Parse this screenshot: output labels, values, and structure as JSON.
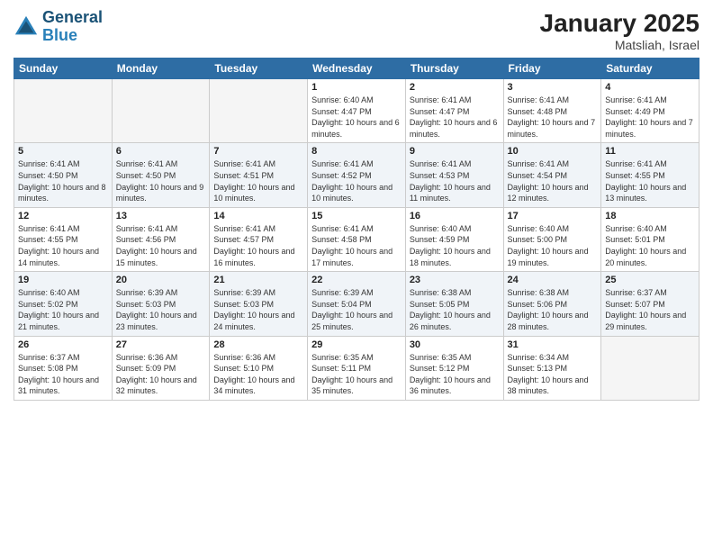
{
  "header": {
    "logo_line1": "General",
    "logo_line2": "Blue",
    "month_title": "January 2025",
    "location": "Matsliah, Israel"
  },
  "weekdays": [
    "Sunday",
    "Monday",
    "Tuesday",
    "Wednesday",
    "Thursday",
    "Friday",
    "Saturday"
  ],
  "weeks": [
    [
      {
        "day": "",
        "sunrise": "",
        "sunset": "",
        "daylight": "",
        "empty": true
      },
      {
        "day": "",
        "sunrise": "",
        "sunset": "",
        "daylight": "",
        "empty": true
      },
      {
        "day": "",
        "sunrise": "",
        "sunset": "",
        "daylight": "",
        "empty": true
      },
      {
        "day": "1",
        "sunrise": "Sunrise: 6:40 AM",
        "sunset": "Sunset: 4:47 PM",
        "daylight": "Daylight: 10 hours and 6 minutes.",
        "empty": false
      },
      {
        "day": "2",
        "sunrise": "Sunrise: 6:41 AM",
        "sunset": "Sunset: 4:47 PM",
        "daylight": "Daylight: 10 hours and 6 minutes.",
        "empty": false
      },
      {
        "day": "3",
        "sunrise": "Sunrise: 6:41 AM",
        "sunset": "Sunset: 4:48 PM",
        "daylight": "Daylight: 10 hours and 7 minutes.",
        "empty": false
      },
      {
        "day": "4",
        "sunrise": "Sunrise: 6:41 AM",
        "sunset": "Sunset: 4:49 PM",
        "daylight": "Daylight: 10 hours and 7 minutes.",
        "empty": false
      }
    ],
    [
      {
        "day": "5",
        "sunrise": "Sunrise: 6:41 AM",
        "sunset": "Sunset: 4:50 PM",
        "daylight": "Daylight: 10 hours and 8 minutes.",
        "empty": false
      },
      {
        "day": "6",
        "sunrise": "Sunrise: 6:41 AM",
        "sunset": "Sunset: 4:50 PM",
        "daylight": "Daylight: 10 hours and 9 minutes.",
        "empty": false
      },
      {
        "day": "7",
        "sunrise": "Sunrise: 6:41 AM",
        "sunset": "Sunset: 4:51 PM",
        "daylight": "Daylight: 10 hours and 10 minutes.",
        "empty": false
      },
      {
        "day": "8",
        "sunrise": "Sunrise: 6:41 AM",
        "sunset": "Sunset: 4:52 PM",
        "daylight": "Daylight: 10 hours and 10 minutes.",
        "empty": false
      },
      {
        "day": "9",
        "sunrise": "Sunrise: 6:41 AM",
        "sunset": "Sunset: 4:53 PM",
        "daylight": "Daylight: 10 hours and 11 minutes.",
        "empty": false
      },
      {
        "day": "10",
        "sunrise": "Sunrise: 6:41 AM",
        "sunset": "Sunset: 4:54 PM",
        "daylight": "Daylight: 10 hours and 12 minutes.",
        "empty": false
      },
      {
        "day": "11",
        "sunrise": "Sunrise: 6:41 AM",
        "sunset": "Sunset: 4:55 PM",
        "daylight": "Daylight: 10 hours and 13 minutes.",
        "empty": false
      }
    ],
    [
      {
        "day": "12",
        "sunrise": "Sunrise: 6:41 AM",
        "sunset": "Sunset: 4:55 PM",
        "daylight": "Daylight: 10 hours and 14 minutes.",
        "empty": false
      },
      {
        "day": "13",
        "sunrise": "Sunrise: 6:41 AM",
        "sunset": "Sunset: 4:56 PM",
        "daylight": "Daylight: 10 hours and 15 minutes.",
        "empty": false
      },
      {
        "day": "14",
        "sunrise": "Sunrise: 6:41 AM",
        "sunset": "Sunset: 4:57 PM",
        "daylight": "Daylight: 10 hours and 16 minutes.",
        "empty": false
      },
      {
        "day": "15",
        "sunrise": "Sunrise: 6:41 AM",
        "sunset": "Sunset: 4:58 PM",
        "daylight": "Daylight: 10 hours and 17 minutes.",
        "empty": false
      },
      {
        "day": "16",
        "sunrise": "Sunrise: 6:40 AM",
        "sunset": "Sunset: 4:59 PM",
        "daylight": "Daylight: 10 hours and 18 minutes.",
        "empty": false
      },
      {
        "day": "17",
        "sunrise": "Sunrise: 6:40 AM",
        "sunset": "Sunset: 5:00 PM",
        "daylight": "Daylight: 10 hours and 19 minutes.",
        "empty": false
      },
      {
        "day": "18",
        "sunrise": "Sunrise: 6:40 AM",
        "sunset": "Sunset: 5:01 PM",
        "daylight": "Daylight: 10 hours and 20 minutes.",
        "empty": false
      }
    ],
    [
      {
        "day": "19",
        "sunrise": "Sunrise: 6:40 AM",
        "sunset": "Sunset: 5:02 PM",
        "daylight": "Daylight: 10 hours and 21 minutes.",
        "empty": false
      },
      {
        "day": "20",
        "sunrise": "Sunrise: 6:39 AM",
        "sunset": "Sunset: 5:03 PM",
        "daylight": "Daylight: 10 hours and 23 minutes.",
        "empty": false
      },
      {
        "day": "21",
        "sunrise": "Sunrise: 6:39 AM",
        "sunset": "Sunset: 5:03 PM",
        "daylight": "Daylight: 10 hours and 24 minutes.",
        "empty": false
      },
      {
        "day": "22",
        "sunrise": "Sunrise: 6:39 AM",
        "sunset": "Sunset: 5:04 PM",
        "daylight": "Daylight: 10 hours and 25 minutes.",
        "empty": false
      },
      {
        "day": "23",
        "sunrise": "Sunrise: 6:38 AM",
        "sunset": "Sunset: 5:05 PM",
        "daylight": "Daylight: 10 hours and 26 minutes.",
        "empty": false
      },
      {
        "day": "24",
        "sunrise": "Sunrise: 6:38 AM",
        "sunset": "Sunset: 5:06 PM",
        "daylight": "Daylight: 10 hours and 28 minutes.",
        "empty": false
      },
      {
        "day": "25",
        "sunrise": "Sunrise: 6:37 AM",
        "sunset": "Sunset: 5:07 PM",
        "daylight": "Daylight: 10 hours and 29 minutes.",
        "empty": false
      }
    ],
    [
      {
        "day": "26",
        "sunrise": "Sunrise: 6:37 AM",
        "sunset": "Sunset: 5:08 PM",
        "daylight": "Daylight: 10 hours and 31 minutes.",
        "empty": false
      },
      {
        "day": "27",
        "sunrise": "Sunrise: 6:36 AM",
        "sunset": "Sunset: 5:09 PM",
        "daylight": "Daylight: 10 hours and 32 minutes.",
        "empty": false
      },
      {
        "day": "28",
        "sunrise": "Sunrise: 6:36 AM",
        "sunset": "Sunset: 5:10 PM",
        "daylight": "Daylight: 10 hours and 34 minutes.",
        "empty": false
      },
      {
        "day": "29",
        "sunrise": "Sunrise: 6:35 AM",
        "sunset": "Sunset: 5:11 PM",
        "daylight": "Daylight: 10 hours and 35 minutes.",
        "empty": false
      },
      {
        "day": "30",
        "sunrise": "Sunrise: 6:35 AM",
        "sunset": "Sunset: 5:12 PM",
        "daylight": "Daylight: 10 hours and 36 minutes.",
        "empty": false
      },
      {
        "day": "31",
        "sunrise": "Sunrise: 6:34 AM",
        "sunset": "Sunset: 5:13 PM",
        "daylight": "Daylight: 10 hours and 38 minutes.",
        "empty": false
      },
      {
        "day": "",
        "sunrise": "",
        "sunset": "",
        "daylight": "",
        "empty": true
      }
    ]
  ]
}
